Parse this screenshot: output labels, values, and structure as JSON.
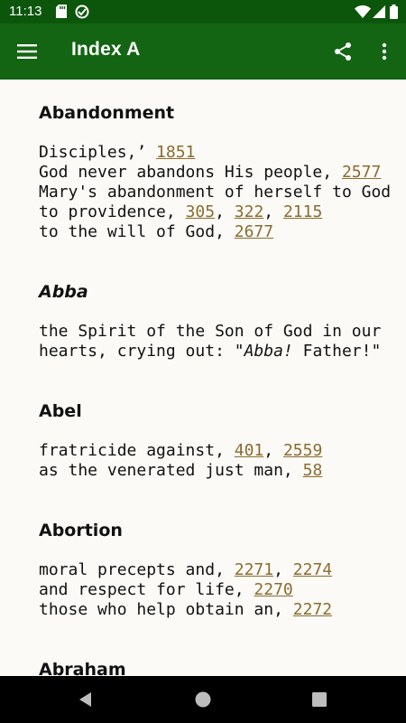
{
  "status": {
    "time": "11:13"
  },
  "app_bar": {
    "title": "Index A"
  },
  "entries": [
    {
      "heading": "Abandonment",
      "italic": false,
      "lines": [
        [
          {
            "t": "Disciples,’ "
          },
          {
            "t": "1851",
            "link": true
          }
        ],
        [
          {
            "t": "God never abandons His people, "
          },
          {
            "t": "2577",
            "link": true
          }
        ],
        [
          {
            "t": "Mary's abandonment of herself to God"
          }
        ],
        [
          {
            "t": "to providence, "
          },
          {
            "t": "305",
            "link": true
          },
          {
            "t": ", "
          },
          {
            "t": "322",
            "link": true
          },
          {
            "t": ", "
          },
          {
            "t": "2115",
            "link": true
          }
        ],
        [
          {
            "t": "to the will of God, "
          },
          {
            "t": "2677",
            "link": true
          }
        ]
      ]
    },
    {
      "heading": "Abba",
      "italic": true,
      "lines": [
        [
          {
            "t": "the Spirit of the Son of God in our"
          }
        ],
        [
          {
            "t": "hearts, crying out: \""
          },
          {
            "t": "Abba!",
            "italic": true
          },
          {
            "t": " Father!\""
          }
        ]
      ]
    },
    {
      "heading": "Abel",
      "italic": false,
      "lines": [
        [
          {
            "t": "fratricide against, "
          },
          {
            "t": "401",
            "link": true
          },
          {
            "t": ", "
          },
          {
            "t": "2559",
            "link": true
          }
        ],
        [
          {
            "t": "as the venerated just man, "
          },
          {
            "t": "58",
            "link": true
          }
        ]
      ]
    },
    {
      "heading": "Abortion",
      "italic": false,
      "lines": [
        [
          {
            "t": "moral precepts and, "
          },
          {
            "t": "2271",
            "link": true
          },
          {
            "t": ", "
          },
          {
            "t": "2274",
            "link": true
          }
        ],
        [
          {
            "t": "and respect for life, "
          },
          {
            "t": "2270",
            "link": true
          }
        ],
        [
          {
            "t": "those who help obtain an, "
          },
          {
            "t": "2272",
            "link": true
          }
        ]
      ]
    },
    {
      "heading": "Abraham",
      "italic": false,
      "lines": []
    }
  ]
}
